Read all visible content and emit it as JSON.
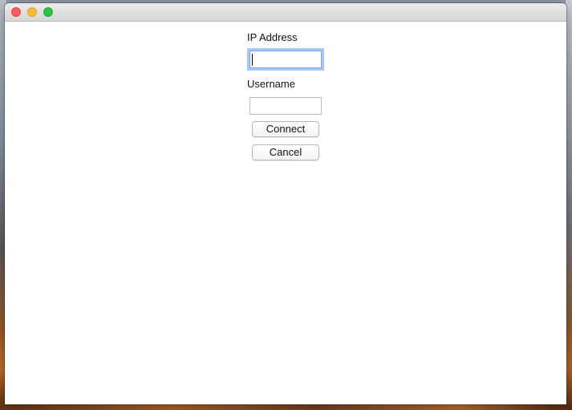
{
  "window": {
    "title": ""
  },
  "form": {
    "ip_label": "IP Address",
    "ip_value": "",
    "username_label": "Username",
    "username_value": "",
    "connect_label": "Connect",
    "cancel_label": "Cancel"
  },
  "colors": {
    "close": "#fc5f57",
    "minimize": "#fdbc2e",
    "zoom": "#28c840",
    "focus_ring": "#a9c9f3"
  }
}
